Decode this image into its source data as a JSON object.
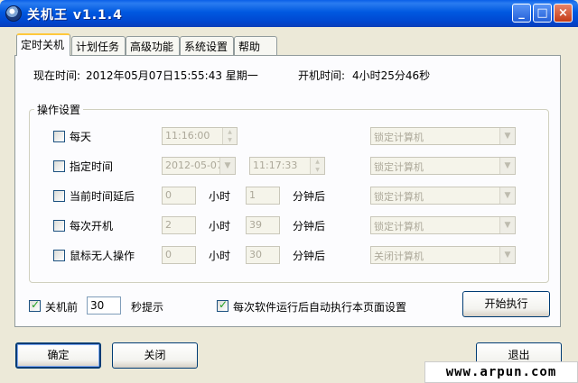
{
  "window": {
    "title": "关机王 v1.1.4",
    "minimize": "_",
    "maximize": "□",
    "close": "×"
  },
  "tabs": [
    {
      "label": "定时关机",
      "active": true
    },
    {
      "label": "计划任务"
    },
    {
      "label": "高级功能"
    },
    {
      "label": "系统设置"
    },
    {
      "label": "帮助"
    }
  ],
  "status": {
    "current_time_label": "现在时间:",
    "current_time": "2012年05月07日15:55:43 星期一",
    "uptime_label": "开机时间:",
    "uptime": "4小时25分46秒"
  },
  "group": {
    "title": "操作设置",
    "rows": [
      {
        "label": "每天",
        "time": "11:16:00",
        "action": "锁定计算机"
      },
      {
        "label": "指定时间",
        "date": "2012-05-07",
        "time": "11:17:33",
        "action": "锁定计算机"
      },
      {
        "label": "当前时间延后",
        "hours": "0",
        "hours_unit": "小时",
        "minutes": "1",
        "minutes_unit": "分钟后",
        "action": "锁定计算机"
      },
      {
        "label": "每次开机",
        "hours": "2",
        "hours_unit": "小时",
        "minutes": "39",
        "minutes_unit": "分钟后",
        "action": "锁定计算机"
      },
      {
        "label": "鼠标无人操作",
        "hours": "0",
        "hours_unit": "小时",
        "minutes": "30",
        "minutes_unit": "分钟后",
        "action": "关闭计算机"
      }
    ]
  },
  "options": {
    "before_shutdown_label": "关机前",
    "before_shutdown_value": "30",
    "seconds_hint": "秒提示",
    "auto_run_label": "每次软件运行后自动执行本页面设置"
  },
  "buttons": {
    "start": "开始执行",
    "ok": "确定",
    "close": "关闭",
    "exit": "退出"
  },
  "watermark": "www.arpun.com"
}
